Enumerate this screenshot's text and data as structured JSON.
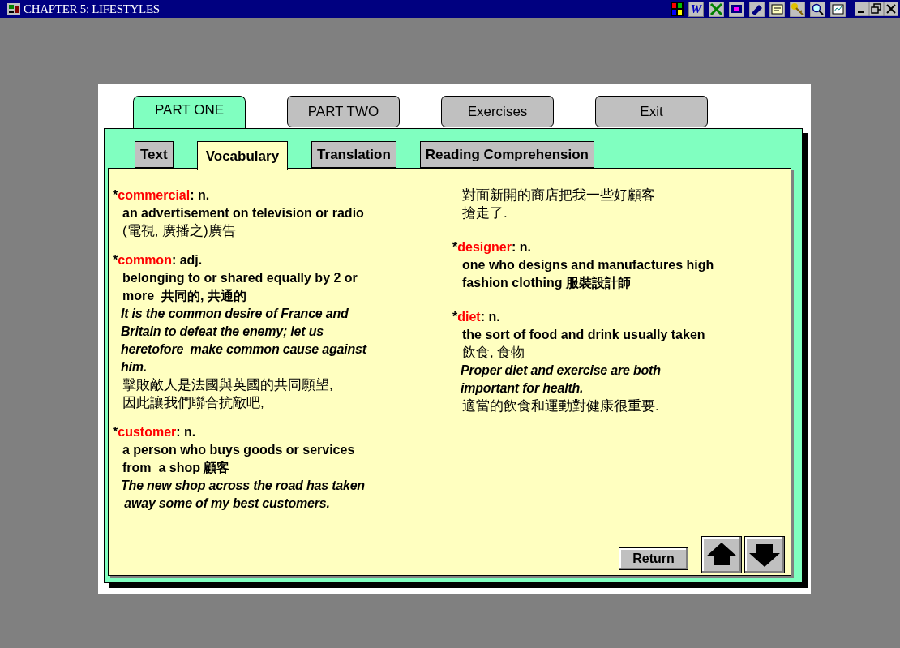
{
  "window": {
    "title": "CHAPTER 5: LIFESTYLES"
  },
  "toolbar": [
    {
      "kind": "grid"
    },
    {
      "kind": "letter",
      "label": "W"
    },
    {
      "kind": "cross"
    },
    {
      "kind": "screen"
    },
    {
      "kind": "pen"
    },
    {
      "kind": "note"
    },
    {
      "kind": "key"
    },
    {
      "kind": "magnifier"
    },
    {
      "kind": "chart"
    }
  ],
  "main_tabs": [
    {
      "label": "PART ONE",
      "selected": true
    },
    {
      "label": "PART TWO",
      "selected": false
    },
    {
      "label": "Exercises",
      "selected": false
    },
    {
      "label": "Exit",
      "selected": false
    }
  ],
  "sub_tabs": [
    {
      "label": "Text",
      "selected": false
    },
    {
      "label": "Vocabulary",
      "selected": true
    },
    {
      "label": "Translation",
      "selected": false
    },
    {
      "label": "Reading Comprehension",
      "selected": false
    }
  ],
  "columns": [
    {
      "entries": [
        {
          "mark": "*",
          "term": "commercial",
          "pos": ": n.",
          "lines": [
            {
              "kind": "definition",
              "text": "an advertisement on television or radio"
            },
            {
              "kind": "translation",
              "text": "(電視, 廣播之)廣告"
            }
          ]
        },
        {
          "mark": "*",
          "term": "common",
          "pos": ": adj.",
          "lines": [
            {
              "kind": "definition",
              "text": "belonging to or shared equally by 2 or"
            },
            {
              "kind": "definition",
              "text": "more  共同的, 共通的"
            },
            {
              "kind": "example",
              "text": "It is the common desire of France and"
            },
            {
              "kind": "example",
              "text": "Britain to defeat the enemy; let us"
            },
            {
              "kind": "example",
              "text": "heretofore  make common cause against"
            },
            {
              "kind": "example",
              "text": "him."
            },
            {
              "kind": "translation",
              "text": "擊敗敵人是法國與英國的共同願望,"
            },
            {
              "kind": "translation",
              "text": "因此讓我們聯合抗敵吧,"
            }
          ]
        },
        {
          "mark": "*",
          "term": "customer",
          "pos": ": n.",
          "lines": [
            {
              "kind": "definition",
              "text": "a person who buys goods or services"
            },
            {
              "kind": "definition",
              "text": "from  a shop 顧客"
            },
            {
              "kind": "example",
              "text": "The new shop across the road has taken"
            },
            {
              "kind": "example",
              "text": " away some of my best customers."
            }
          ]
        }
      ]
    },
    {
      "entries": [
        {
          "lines": [
            {
              "kind": "translation",
              "text": "對面新開的商店把我一些好顧客"
            },
            {
              "kind": "translation",
              "text": "搶走了."
            }
          ]
        },
        {
          "mark": "*",
          "term": "designer",
          "pos": ": n.",
          "lines": [
            {
              "kind": "definition",
              "text": "one who designs and manufactures high"
            },
            {
              "kind": "definition",
              "text": "fashion clothing 服裝設計師"
            }
          ]
        },
        {
          "mark": "*",
          "term": "diet",
          "pos": ": n.",
          "lines": [
            {
              "kind": "definition",
              "text": "the sort of food and drink usually taken"
            },
            {
              "kind": "translation",
              "text": "飲食, 食物"
            },
            {
              "kind": "example",
              "text": "Proper diet and exercise are both"
            },
            {
              "kind": "example",
              "text": "important for health."
            },
            {
              "kind": "translation",
              "text": "適當的飲食和運動對健康很重要."
            }
          ]
        }
      ]
    }
  ],
  "return_button": "Return"
}
